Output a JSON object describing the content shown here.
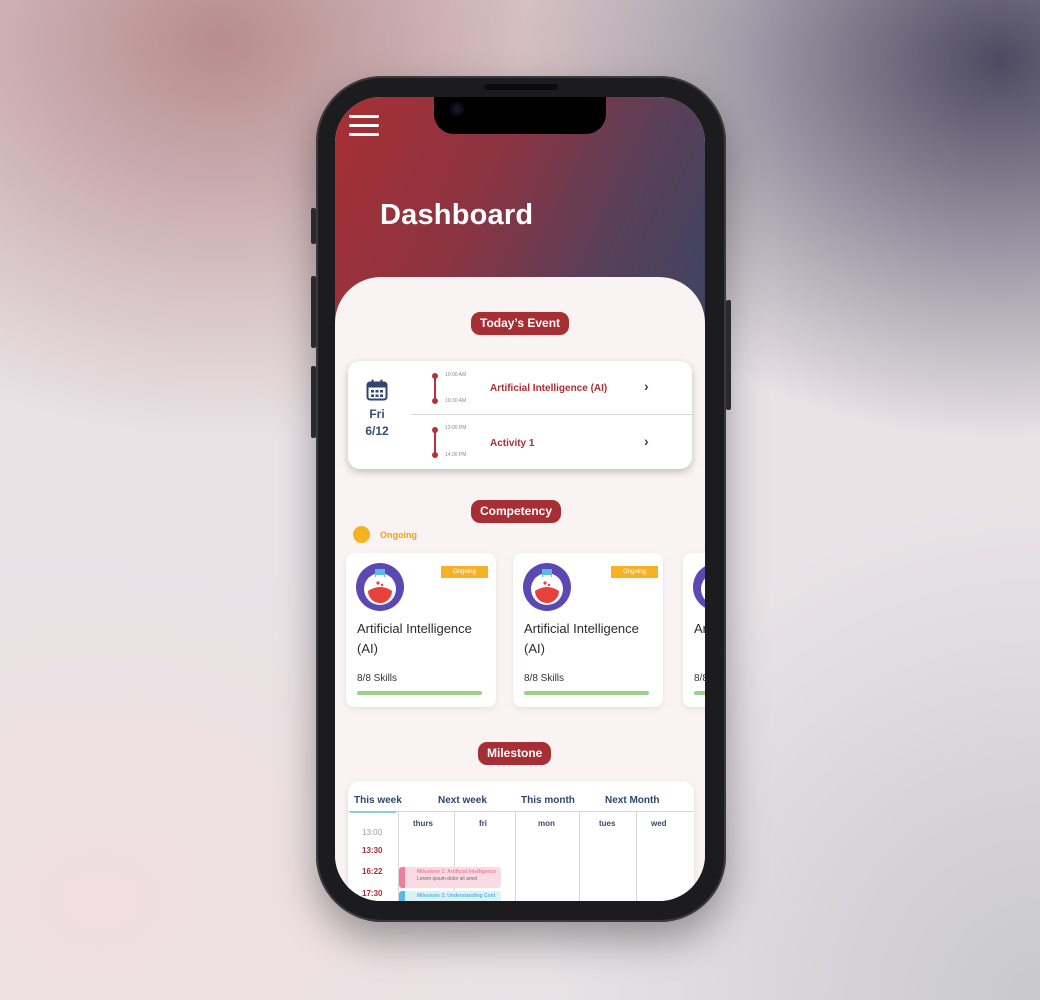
{
  "header": {
    "title": "Dashboard"
  },
  "sections": {
    "todays_event": "Today’s Event",
    "competency": "Competency",
    "milestone": "Milestone"
  },
  "today_event": {
    "day": "Fri",
    "date": "6/12",
    "events": [
      {
        "start": "10:00 AM",
        "end": "10:30 AM",
        "label": "Artificial Intelligence (AI)"
      },
      {
        "start": "13:00 PM",
        "end": "14:30 PM",
        "label": "Activity 1"
      }
    ]
  },
  "competency": {
    "legend": "Ongoing",
    "cards": [
      {
        "badge": "Ongoing",
        "title": "Artificial Intelligence (AI)",
        "skills": "8/8 Skills",
        "progress": 1.0
      },
      {
        "badge": "Ongoing",
        "title": "Artificial Intelligence (AI)",
        "skills": "8/8 Skills",
        "progress": 1.0
      },
      {
        "badge": "",
        "title": "Ar (A",
        "skills": "8/8",
        "progress": 1.0
      }
    ]
  },
  "milestone": {
    "tabs": [
      "This week",
      "Next week",
      "This month",
      "Next Month"
    ],
    "active_tab": "This week",
    "columns": [
      "thurs",
      "fri",
      "mon",
      "tues",
      "wed"
    ],
    "times": [
      "13:00",
      "13:30",
      "16:22",
      "17:30"
    ],
    "events": [
      {
        "title": "Milestone 1: Artificial Intelligence",
        "desc": "Lorem ipsum dolor sit amet"
      },
      {
        "title": "Milestone 2: Understanding Cont",
        "desc": ""
      }
    ]
  },
  "colors": {
    "accent": "#a62f36",
    "navy": "#2e4670",
    "ongoing": "#f6b21f",
    "progress": "#9fd08b"
  }
}
